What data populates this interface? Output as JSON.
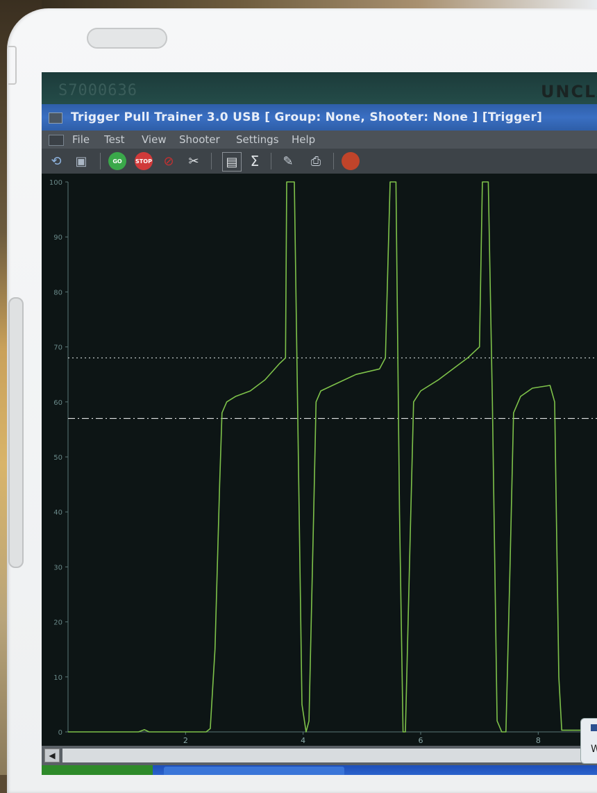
{
  "screen": {
    "classification_left": "S7000636",
    "classification_right": "UNCLA"
  },
  "window": {
    "title": "Trigger Pull Trainer 3.0 USB [ Group: None, Shooter: None ]  [Trigger]"
  },
  "menu": {
    "items": [
      "File",
      "Test",
      "View",
      "Shooter",
      "Settings",
      "Help"
    ]
  },
  "toolbar": {
    "buttons": [
      {
        "icon": "open-icon"
      },
      {
        "icon": "save-icon"
      },
      {
        "icon": "go-icon",
        "label": "GO",
        "color": "#3aa84a"
      },
      {
        "icon": "stop-icon",
        "label": "STOP",
        "color": "#d03a3a"
      },
      {
        "icon": "cancel-icon",
        "color": "#c83030"
      },
      {
        "icon": "tools-icon"
      },
      {
        "icon": "display-icon"
      },
      {
        "icon": "sigma-icon",
        "label": "Σ"
      },
      {
        "icon": "chat-icon"
      },
      {
        "icon": "print-icon"
      },
      {
        "icon": "record-icon",
        "color": "#c0442a"
      }
    ]
  },
  "taskbar_popup": {
    "label": "W"
  },
  "chart_data": {
    "type": "line",
    "xlabel": "",
    "ylabel": "",
    "xlim": [
      0,
      9
    ],
    "ylim": [
      0,
      100
    ],
    "x_ticks": [
      2,
      4,
      6,
      8
    ],
    "y_ticks": [
      0,
      10,
      20,
      30,
      40,
      50,
      60,
      70,
      80,
      90,
      100
    ],
    "grid": false,
    "reference_lines": [
      {
        "y": 68,
        "style": "dotted",
        "color": "#cfd6d6"
      },
      {
        "y": 57,
        "style": "dash-dot",
        "color": "#e0e4e4"
      }
    ],
    "series": [
      {
        "color": "#7ec24a",
        "points": [
          [
            0.0,
            0
          ],
          [
            1.2,
            0
          ],
          [
            1.3,
            0.4
          ],
          [
            1.38,
            0
          ],
          [
            2.35,
            0
          ],
          [
            2.42,
            0.6
          ],
          [
            2.5,
            15
          ],
          [
            2.58,
            45
          ],
          [
            2.62,
            58
          ],
          [
            2.7,
            60
          ],
          [
            2.85,
            61
          ],
          [
            3.1,
            62
          ],
          [
            3.35,
            64
          ],
          [
            3.6,
            67
          ],
          [
            3.7,
            68
          ],
          [
            3.72,
            100
          ],
          [
            3.82,
            100
          ],
          [
            3.85,
            100
          ],
          [
            3.98,
            5
          ],
          [
            4.05,
            0
          ],
          [
            4.1,
            2
          ],
          [
            4.18,
            40
          ],
          [
            4.22,
            60
          ],
          [
            4.3,
            62
          ],
          [
            4.5,
            63
          ],
          [
            4.9,
            65
          ],
          [
            5.3,
            66
          ],
          [
            5.4,
            68
          ],
          [
            5.48,
            100
          ],
          [
            5.58,
            100
          ],
          [
            5.64,
            40
          ],
          [
            5.7,
            0
          ],
          [
            5.74,
            0
          ],
          [
            5.82,
            35
          ],
          [
            5.88,
            60
          ],
          [
            6.0,
            62
          ],
          [
            6.3,
            64
          ],
          [
            6.8,
            68
          ],
          [
            7.0,
            70
          ],
          [
            7.05,
            100
          ],
          [
            7.15,
            100
          ],
          [
            7.22,
            60
          ],
          [
            7.3,
            2
          ],
          [
            7.38,
            0
          ],
          [
            7.45,
            0
          ],
          [
            7.52,
            30
          ],
          [
            7.58,
            58
          ],
          [
            7.7,
            61
          ],
          [
            7.9,
            62.5
          ],
          [
            8.2,
            63
          ],
          [
            8.28,
            60
          ],
          [
            8.35,
            10
          ],
          [
            8.4,
            0.3
          ],
          [
            9.0,
            0.3
          ]
        ]
      }
    ]
  }
}
